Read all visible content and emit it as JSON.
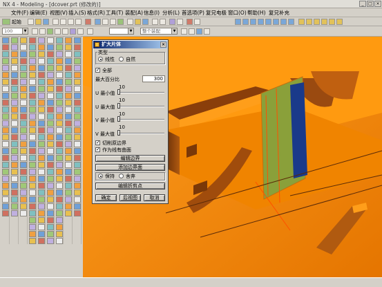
{
  "window": {
    "title": "NX 4 - Modeling - [dcover.prt (修改的)]",
    "controls": [
      "_",
      "□",
      "×"
    ]
  },
  "menu": {
    "items": [
      "文件(F)",
      "编辑(E)",
      "视图(V)",
      "插入(S)",
      "格式(R)",
      "工具(T)",
      "装配(A)",
      "信息(I)",
      "分析(L)",
      "首选项(P)",
      "复兄电极",
      "窗口(O)",
      "帮助(H)",
      "复兄补充"
    ]
  },
  "toolbar": {
    "start_label": "起始",
    "filter_combo": "",
    "assembly_combo": "整个装配",
    "zoom_combo": "100"
  },
  "dialog": {
    "title": "扩大片体",
    "close": "×",
    "type_group_label": "类型",
    "type_options": [
      "线性",
      "自然"
    ],
    "type_selected": "线性",
    "all_label": "全部",
    "all_checked": true,
    "max_percent_label": "最大百分比",
    "max_percent_value": "300",
    "sliders": [
      {
        "label": "U 最小值",
        "value": "10"
      },
      {
        "label": "U 最大值",
        "value": "10"
      },
      {
        "label": "V 最小值",
        "value": "10"
      },
      {
        "label": "V 最大值",
        "value": "10"
      }
    ],
    "trim_boundary_label": "切削原边界",
    "trim_boundary_checked": true,
    "as_rigid_label": "作为线有曲面",
    "as_rigid_checked": true,
    "edit_boundary_button": "编辑边界",
    "add_boundary_button": "添加边界面",
    "keep_options": [
      "保持",
      "舍弃"
    ],
    "keep_selected": "保持",
    "edit_split_button": "编辑折剪点",
    "ok_button": "确定",
    "back_button": "后视图",
    "cancel_button": "取消"
  },
  "colors": {
    "model_orange": "#ff8c00",
    "model_shadow": "#5a2a08",
    "selected_sheet": "#8aa03a",
    "dialog_title": "#0a246a"
  }
}
